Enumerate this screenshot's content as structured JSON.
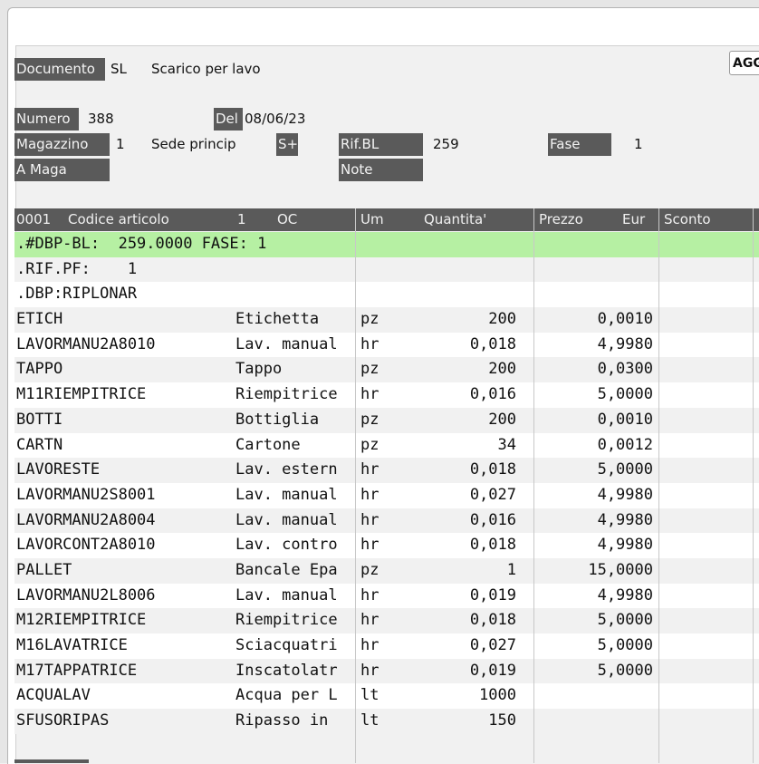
{
  "header": {
    "documento_label": "Documento",
    "documento_code": "SL",
    "documento_desc": "Scarico per lavo",
    "ago_button": "AGG",
    "numero_label": "Numero",
    "numero_value": "388",
    "del_label": "Del",
    "del_value": "08/06/23",
    "magazzino_label": "Magazzino",
    "magazzino_value": "1",
    "sede": "Sede princip",
    "sede_sign": "S+",
    "rifbl_label": "Rif.BL",
    "rifbl_value": "259",
    "fase_label": "Fase",
    "fase_value": "1",
    "amaga_label": "A Maga",
    "note_label": "Note"
  },
  "grid": {
    "columns": {
      "row_no": "0001",
      "code": "Codice articolo",
      "one": "1",
      "oc": "OC",
      "um": "Um",
      "qty": "Quantita'",
      "price": "Prezzo",
      "eur": "Eur",
      "discount": "Sconto"
    },
    "rows": [
      {
        "code": ".#DBP-BL:  259.0000 FASE: 1",
        "desc": "",
        "um": "",
        "qty": "",
        "price": "",
        "highlight": true
      },
      {
        "code": ".RIF.PF:    1",
        "desc": "",
        "um": "",
        "qty": "",
        "price": ""
      },
      {
        "code": ".DBP:RIPLONAR",
        "desc": "",
        "um": "",
        "qty": "",
        "price": ""
      },
      {
        "code": "ETICH",
        "desc": "Etichetta",
        "um": "pz",
        "qty": "200",
        "price": "0,0010"
      },
      {
        "code": "LAVORMANU2A8010",
        "desc": "Lav. manual",
        "um": "hr",
        "qty": "0,018",
        "price": "4,9980"
      },
      {
        "code": "TAPPO",
        "desc": "Tappo",
        "um": "pz",
        "qty": "200",
        "price": "0,0300"
      },
      {
        "code": "M11RIEMPITRICE",
        "desc": "Riempitrice",
        "um": "hr",
        "qty": "0,016",
        "price": "5,0000"
      },
      {
        "code": "BOTTI",
        "desc": "Bottiglia",
        "um": "pz",
        "qty": "200",
        "price": "0,0010"
      },
      {
        "code": "CARTN",
        "desc": "Cartone",
        "um": "pz",
        "qty": "34",
        "price": "0,0012"
      },
      {
        "code": "LAVORESTE",
        "desc": "Lav. estern",
        "um": "hr",
        "qty": "0,018",
        "price": "5,0000"
      },
      {
        "code": "LAVORMANU2S8001",
        "desc": "Lav. manual",
        "um": "hr",
        "qty": "0,027",
        "price": "4,9980"
      },
      {
        "code": "LAVORMANU2A8004",
        "desc": "Lav. manual",
        "um": "hr",
        "qty": "0,016",
        "price": "4,9980"
      },
      {
        "code": "LAVORCONT2A8010",
        "desc": "Lav. contro",
        "um": "hr",
        "qty": "0,018",
        "price": "4,9980"
      },
      {
        "code": "PALLET",
        "desc": "Bancale Epa",
        "um": "pz",
        "qty": "1",
        "price": "15,0000"
      },
      {
        "code": "LAVORMANU2L8006",
        "desc": "Lav. manual",
        "um": "hr",
        "qty": "0,019",
        "price": "4,9980"
      },
      {
        "code": "M12RIEMPITRICE",
        "desc": "Riempitrice",
        "um": "hr",
        "qty": "0,018",
        "price": "5,0000"
      },
      {
        "code": "M16LAVATRICE",
        "desc": "Sciacquatri",
        "um": "hr",
        "qty": "0,027",
        "price": "5,0000"
      },
      {
        "code": "M17TAPPATRICE",
        "desc": "Inscatolatr",
        "um": "hr",
        "qty": "0,019",
        "price": "5,0000"
      },
      {
        "code": "ACQUALAV",
        "desc": "Acqua per L",
        "um": "lt",
        "qty": "1000",
        "price": ""
      },
      {
        "code": "SFUSORIPAS",
        "desc": "Ripasso in",
        "um": "lt",
        "qty": "150",
        "price": ""
      }
    ]
  }
}
